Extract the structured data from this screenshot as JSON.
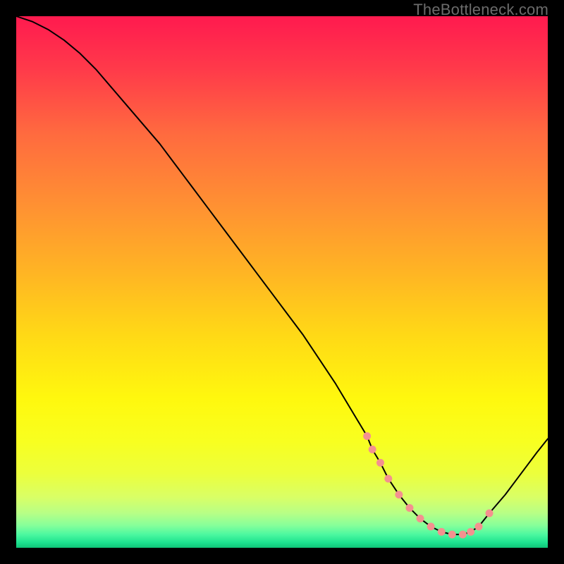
{
  "watermark": "TheBottleneck.com",
  "chart_data": {
    "type": "line",
    "title": "",
    "xlabel": "",
    "ylabel": "",
    "xlim": [
      0,
      100
    ],
    "ylim": [
      0,
      100
    ],
    "grid": false,
    "x": [
      0,
      3,
      6,
      9,
      12,
      15,
      18,
      21,
      24,
      27,
      30,
      33,
      36,
      39,
      42,
      45,
      48,
      51,
      54,
      57,
      60,
      63,
      66,
      67,
      68.5,
      70,
      72,
      74,
      76,
      78,
      80,
      82,
      84,
      85.5,
      87,
      89,
      92,
      95,
      98,
      100
    ],
    "values": [
      100,
      99,
      97.5,
      95.5,
      93,
      90,
      86.5,
      83,
      79.5,
      76,
      72,
      68,
      64,
      60,
      56,
      52,
      48,
      44,
      40,
      35.5,
      31,
      26,
      21,
      18.5,
      16,
      13,
      10,
      7.5,
      5.5,
      4,
      3,
      2.5,
      2.5,
      3,
      4,
      6.5,
      10,
      14,
      18,
      20.5
    ],
    "markers": {
      "x": [
        66,
        67,
        68.5,
        70,
        72,
        74,
        76,
        78,
        80,
        82,
        84,
        85.5,
        87,
        89
      ],
      "values": [
        21,
        18.5,
        16,
        13,
        10,
        7.5,
        5.5,
        4,
        3,
        2.5,
        2.5,
        3,
        4,
        6.5
      ],
      "color": "#f4918f",
      "radius": 5.5
    },
    "gradient_stops": [
      {
        "offset": 0.0,
        "color": "#ff1a4f"
      },
      {
        "offset": 0.1,
        "color": "#ff3a4a"
      },
      {
        "offset": 0.22,
        "color": "#ff6a3f"
      },
      {
        "offset": 0.35,
        "color": "#ff8f33"
      },
      {
        "offset": 0.48,
        "color": "#ffb424"
      },
      {
        "offset": 0.6,
        "color": "#ffd916"
      },
      {
        "offset": 0.72,
        "color": "#fff80e"
      },
      {
        "offset": 0.8,
        "color": "#f8ff20"
      },
      {
        "offset": 0.86,
        "color": "#ecff3c"
      },
      {
        "offset": 0.905,
        "color": "#d9ff66"
      },
      {
        "offset": 0.935,
        "color": "#b7ff86"
      },
      {
        "offset": 0.958,
        "color": "#86ff9a"
      },
      {
        "offset": 0.975,
        "color": "#4cf8a0"
      },
      {
        "offset": 0.99,
        "color": "#1de28f"
      },
      {
        "offset": 1.0,
        "color": "#0fc477"
      }
    ]
  }
}
